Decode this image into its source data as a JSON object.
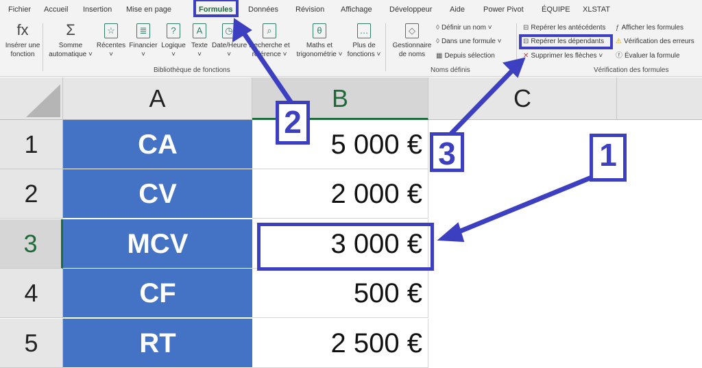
{
  "tabs": [
    "Fichier",
    "Accueil",
    "Insertion",
    "Mise en page",
    "Formules",
    "Données",
    "Révision",
    "Affichage",
    "Développeur",
    "Aide",
    "Power Pivot",
    "ÉQUIPE",
    "XLSTAT"
  ],
  "ribbon": {
    "lib": [
      {
        "l1": "Insérer une",
        "l2": "fonction",
        "icon": "fx"
      },
      {
        "l1": "Somme",
        "l2": "automatique ˅",
        "icon": "Σ"
      },
      {
        "l1": "Récentes",
        "l2": "˅",
        "icon": "☆"
      },
      {
        "l1": "Financier",
        "l2": "˅",
        "icon": "≣"
      },
      {
        "l1": "Logique",
        "l2": "˅",
        "icon": "?"
      },
      {
        "l1": "Texte",
        "l2": "˅",
        "icon": "A"
      },
      {
        "l1": "Date/Heure",
        "l2": "˅",
        "icon": "◷"
      },
      {
        "l1": "Recherche et",
        "l2": "référence ˅",
        "icon": "⌕"
      },
      {
        "l1": "Maths et",
        "l2": "trigonométrie ˅",
        "icon": "θ"
      },
      {
        "l1": "Plus de",
        "l2": "fonctions ˅",
        "icon": "…"
      }
    ],
    "lib_group": "Bibliothèque de fonctions",
    "names_manager": {
      "l1": "Gestionnaire",
      "l2": "de noms"
    },
    "names": [
      "Définir un nom ˅",
      "Dans une formule ˅",
      "Depuis sélection"
    ],
    "names_group": "Noms définis",
    "audit_left": [
      "Repérer les antécédents",
      "Repérer les dépendants",
      "Supprimer les flèches ˅"
    ],
    "audit_right": [
      "Afficher les formules",
      "Vérification des erreurs",
      "Évaluer la formule"
    ],
    "audit_group": "Vérification des formules"
  },
  "columns": [
    "A",
    "B",
    "C"
  ],
  "rows": [
    {
      "n": "1",
      "a": "CA",
      "b": "5 000 €"
    },
    {
      "n": "2",
      "a": "CV",
      "b": "2 000 €"
    },
    {
      "n": "3",
      "a": "MCV",
      "b": "3 000 €"
    },
    {
      "n": "4",
      "a": "CF",
      "b": "500 €"
    },
    {
      "n": "5",
      "a": "RT",
      "b": "2 500 €"
    }
  ],
  "annotations": [
    "1",
    "2",
    "3"
  ],
  "colors": {
    "annotation": "#3b3fc0",
    "cell_fill": "#4472c4",
    "header_active": "#1e6b3a"
  }
}
